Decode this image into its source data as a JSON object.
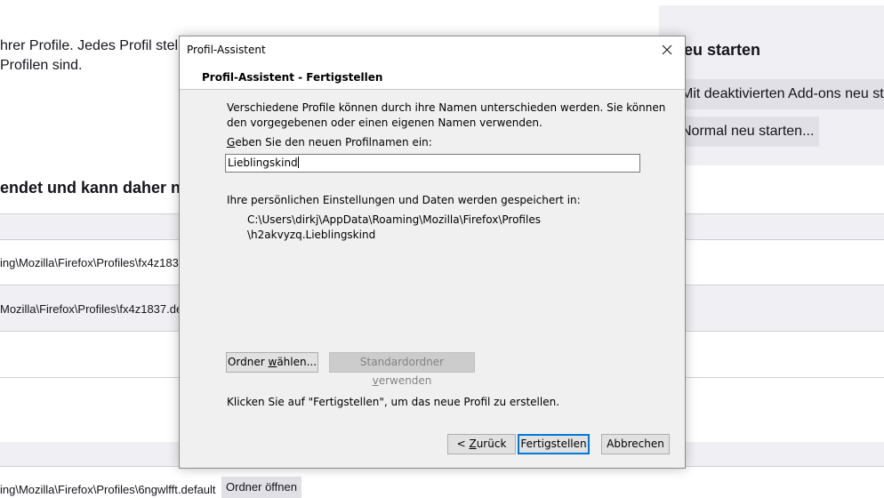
{
  "background": {
    "intro_line1": "hrer Profile. Jedes Profil stellt",
    "intro_line2": " Profilen sind.",
    "heading_partial": "endet und kann daher n",
    "row1_path": "ing\\Mozilla\\Firefox\\Profiles\\fx4z183",
    "row2_path": "Mozilla\\Firefox\\Profiles\\fx4z1837.de",
    "row3_path": "ing\\Mozilla\\Firefox\\Profiles\\6ngwlfft.default",
    "open_folder_button": "Ordner öffnen",
    "restart_heading": "eu starten",
    "restart_addons_button": "Mit deaktivierten Add-ons neu st",
    "restart_normal_button": "Normal neu starten..."
  },
  "dialog": {
    "window_title": "Profil-Assistent",
    "header_title": "Profil-Assistent - Fertigstellen",
    "description_line1": "Verschiedene Profile können durch ihre Namen unterschieden werden. Sie können",
    "description_line2": "den vorgegebenen oder einen eigenen Namen verwenden.",
    "name_label_accesskey": "G",
    "name_label_rest": "eben Sie den neuen Profilnamen ein:",
    "profile_name_value": "Lieblingskind",
    "storage_label": "Ihre persönlichen Einstellungen und Daten werden gespeichert in:",
    "storage_path_line1": "C:\\Users\\dirkj\\AppData\\Roaming\\Mozilla\\Firefox\\Profiles",
    "storage_path_line2": "\\h2akvyzq.Lieblingskind",
    "choose_folder_pre": "Ordner ",
    "choose_folder_key": "w",
    "choose_folder_post": "ählen...",
    "default_folder_pre": "Standardordner ",
    "default_folder_key": "v",
    "default_folder_post": "erwenden",
    "finish_hint": "Klicken Sie auf \"Fertigstellen\", um das neue Profil zu erstellen.",
    "back_pre": "< ",
    "back_key": "Z",
    "back_post": "urück",
    "finish_button": "Fertigstellen",
    "cancel_button": "Abbrechen"
  },
  "colors": {
    "accent": "#0078d7",
    "dialog_bg": "#f0f0f0",
    "page_band": "#f0f0f4"
  }
}
